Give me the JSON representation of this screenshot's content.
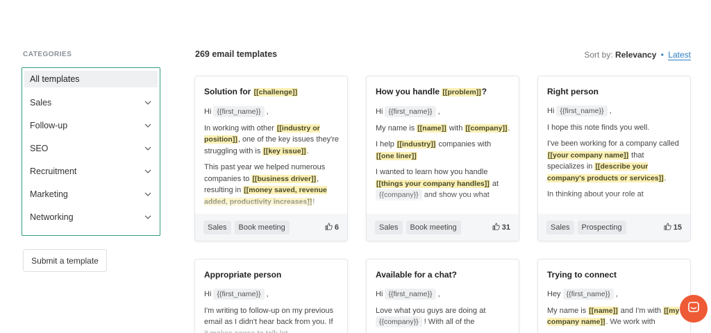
{
  "sidebar": {
    "title": "CATEGORIES",
    "items": [
      {
        "label": "All templates",
        "active": true
      },
      {
        "label": "Sales"
      },
      {
        "label": "Follow-up"
      },
      {
        "label": "SEO"
      },
      {
        "label": "Recruitment"
      },
      {
        "label": "Marketing"
      },
      {
        "label": "Networking"
      }
    ],
    "submit_label": "Submit a template"
  },
  "header": {
    "count_label": "269 email templates",
    "sort_prefix": "Sort by:",
    "sort_relevancy": "Relevancy",
    "sort_sep": "•",
    "sort_latest": "Latest"
  },
  "cards": [
    {
      "title_pre": "Solution for ",
      "title_hl": "[[challenge]]",
      "greet": "Hi",
      "var": "{{first_name}}",
      "comma": ",",
      "tags": [
        "Sales",
        "Book meeting"
      ],
      "likes": "6"
    },
    {
      "title_pre": "How you handle ",
      "title_hl": "[[problem]]",
      "title_post": "?",
      "greet": "Hi",
      "var": "{{first_name}}",
      "comma": ",",
      "tags": [
        "Sales",
        "Book meeting"
      ],
      "likes": "31"
    },
    {
      "title_pre": "Right person",
      "greet": "Hi",
      "var": "{{first_name}}",
      "comma": ",",
      "tags": [
        "Sales",
        "Prospecting"
      ],
      "likes": "15"
    },
    {
      "title_pre": "Appropriate person",
      "greet": "Hi",
      "var": "{{first_name}}",
      "comma": ","
    },
    {
      "title_pre": "Available for a chat?",
      "greet": "Hi",
      "var": "{{first_name}}",
      "comma": ","
    },
    {
      "title_pre": "Trying to connect",
      "greet": "Hey",
      "var": "{{first_name}}",
      "comma": ","
    }
  ],
  "text": {
    "c1_p1a": "In working with other ",
    "c1_p1b": "[[industry or position]]",
    "c1_p1c": ", one of the key issues they're struggling with is ",
    "c1_p1d": "[[key issue]]",
    "c1_p1e": ".",
    "c1_p2a": "This past year we helped numerous companies to ",
    "c1_p2b": "[[business driver]]",
    "c1_p2c": ", resulting in ",
    "c1_p2d": "[[money saved, revenue added, productivity increases]]",
    "c1_p2e": "!",
    "c2_p1a": "My name is ",
    "c2_p1b": "[[name]]",
    "c2_p1c": " with ",
    "c2_p1d": "[[company]]",
    "c2_p1e": ".",
    "c2_p2a": "I help ",
    "c2_p2b": "[[industry]]",
    "c2_p2c": " companies with ",
    "c2_p2d": "[[one liner]]",
    "c2_p3a": "I wanted to learn how you handle ",
    "c2_p3b": "[[things your company handles]]",
    "c2_p3c": " at ",
    "c2_p3d": "{{company}}",
    "c2_p3e": " and show you what",
    "c3_p1": "I hope this note finds you well.",
    "c3_p2a": "I've been working for a company called ",
    "c3_p2b": "[[your company name]]",
    "c3_p2c": " that specializes in ",
    "c3_p2d": "[[describe your company's products or services]]",
    "c3_p2e": ".",
    "c3_p3": "In thinking about your role at",
    "c4_p1": "I'm writing to follow-up on my previous email as I didn't hear back from you. If it makes sense to talk let",
    "c5_p1a": "Love what you guys are doing at ",
    "c5_p1b": "{{company}}",
    "c5_p1c": " ! With all of the",
    "c6_p1a": "My name is ",
    "c6_p1b": "[[name]]",
    "c6_p1c": " and I'm with ",
    "c6_p1d": "[[my company name]]",
    "c6_p1e": ". We work with"
  },
  "colors": {
    "accent": "#2f9c82",
    "link": "#2b7cc4",
    "highlight": "#fbf0b5",
    "chat": "#ee5a35"
  }
}
